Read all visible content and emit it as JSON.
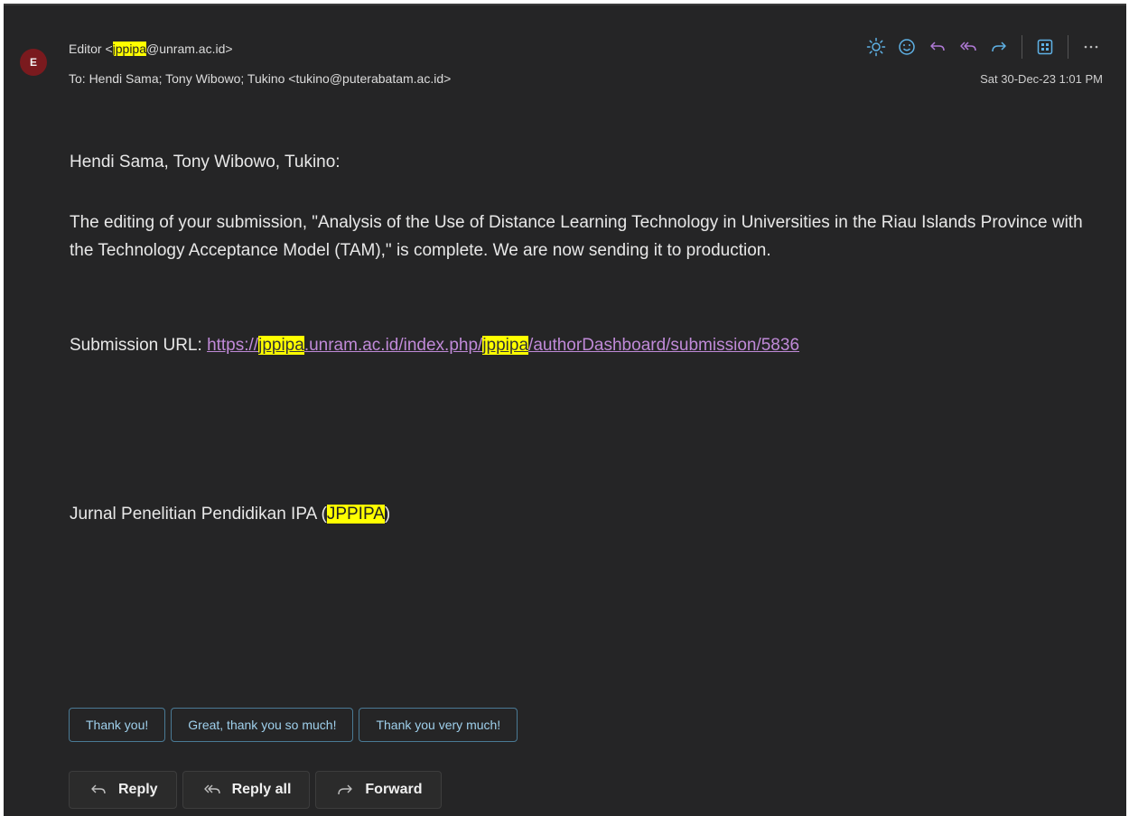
{
  "header": {
    "avatar_letter": "E",
    "from_prefix": "Editor <",
    "from_highlight": "jppipa",
    "from_suffix": "@unram.ac.id>",
    "to_line": "To:  Hendi Sama;  Tony Wibowo;  Tukino <tukino@puterabatam.ac.id>",
    "timestamp": "Sat 30-Dec-23 1:01 PM",
    "toolbar_icons": [
      "brightness-icon",
      "emoji-icon",
      "reply-icon",
      "reply-all-icon",
      "forward-icon",
      "apps-icon",
      "more-icon"
    ]
  },
  "body": {
    "greeting": "Hendi Sama, Tony Wibowo, Tukino:",
    "paragraph": "The editing of your submission, \"Analysis of the Use of Distance Learning Technology in Universities in the Riau Islands Province with the Technology Acceptance Model (TAM),\" is complete. We are now sending it to production.",
    "url_label": "Submission URL: ",
    "url_part1": "https://",
    "url_hl1": "jppipa",
    "url_part2": ".unram.ac.id/index.php/",
    "url_hl2": "jppipa",
    "url_part3": "/authorDashboard/submission/5836",
    "signature_prefix": "Jurnal Penelitian Pendidikan IPA (",
    "signature_highlight": "JPPIPA",
    "signature_suffix": ")"
  },
  "quick_replies": [
    "Thank you!",
    "Great, thank you so much!",
    "Thank you very much!"
  ],
  "actions": {
    "reply": "Reply",
    "reply_all": "Reply all",
    "forward": "Forward"
  },
  "colors": {
    "background": "#252526",
    "highlight": "#ffff00",
    "link": "#c08ad8",
    "chip_border": "#4a7a95",
    "chip_text": "#9fd0ec",
    "icon_blue": "#5fb2e6",
    "icon_purple": "#b07ad6",
    "avatar": "#7a1a1e"
  }
}
